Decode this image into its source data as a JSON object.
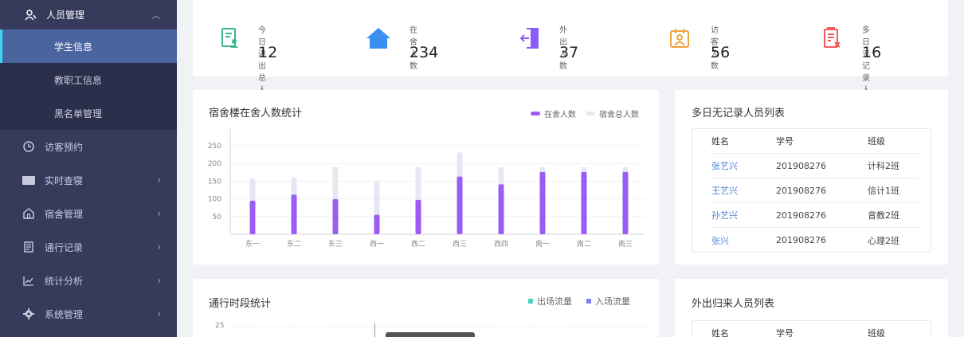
{
  "sidebar": {
    "people": {
      "label": "人员管理"
    },
    "sub_items": [
      {
        "label": "学生信息",
        "active": true
      },
      {
        "label": "教职工信息",
        "active": false
      },
      {
        "label": "黑名单管理",
        "active": false
      }
    ],
    "items": [
      {
        "label": "访客预约",
        "icon": "clock-icon",
        "has_arrow": false
      },
      {
        "label": "实时查寝",
        "icon": "folder-icon",
        "has_arrow": true
      },
      {
        "label": "宿舍管理",
        "icon": "house-icon",
        "has_arrow": true
      },
      {
        "label": "通行记录",
        "icon": "document-icon",
        "has_arrow": true
      },
      {
        "label": "统计分析",
        "icon": "line-chart-icon",
        "has_arrow": true
      },
      {
        "label": "系统管理",
        "icon": "gear-icon",
        "has_arrow": true
      }
    ]
  },
  "stats": [
    {
      "label": "今日进出总人数",
      "value": "12",
      "icon": "clipboard-person-icon",
      "color": "#3bb98c"
    },
    {
      "label": "在舍人数",
      "value": "234",
      "icon": "home-icon",
      "color": "#3a8ff0"
    },
    {
      "label": "外出人数",
      "value": "37",
      "icon": "exit-door-icon",
      "color": "#8b5cf6"
    },
    {
      "label": "访客人数",
      "value": "56",
      "icon": "calendar-person-icon",
      "color": "#f0a23a"
    },
    {
      "label": "多日无记录人数",
      "value": "16",
      "icon": "clipboard-x-icon",
      "color": "#f05a5a"
    }
  ],
  "dorm_chart": {
    "title": "宿舍楼在舍人数统计",
    "legend": [
      "在舍人数",
      "宿舍总人数"
    ]
  },
  "chart_data": {
    "type": "bar",
    "categories": [
      "东一",
      "东二",
      "东三",
      "西一",
      "西二",
      "西三",
      "西四",
      "南一",
      "南二",
      "南三"
    ],
    "series": [
      {
        "name": "在舍人数",
        "values": [
          95,
          112,
          99,
          55,
          97,
          163,
          141,
          176,
          176,
          176
        ]
      },
      {
        "name": "宿舍总人数",
        "values": [
          158,
          162,
          191,
          151,
          190,
          232,
          190,
          190,
          190,
          190
        ]
      }
    ],
    "yticks": [
      50,
      100,
      150,
      200,
      250
    ],
    "ylim": [
      0,
      250
    ],
    "colors": {
      "stay": "#9b5cf6",
      "total": "#e4e8f3"
    }
  },
  "no_record_list": {
    "title": "多日无记录人员列表",
    "headers": [
      "姓名",
      "学号",
      "班级"
    ],
    "rows": [
      [
        "张艺兴",
        "201908276",
        "计科2班"
      ],
      [
        "王艺兴",
        "201908276",
        "信计1班"
      ],
      [
        "孙艺兴",
        "201908276",
        "音教2班"
      ],
      [
        "张兴",
        "201908276",
        "心理2班"
      ]
    ]
  },
  "traffic_chart": {
    "title": "通行时段统计",
    "legend": [
      "出场流量",
      "入场流量"
    ],
    "legend_colors": [
      "#4fd1c5",
      "#7b7ff2"
    ],
    "ytick_top": "25"
  },
  "return_list": {
    "title": "外出归来人员列表",
    "headers": [
      "姓名",
      "学号",
      "班级"
    ]
  }
}
